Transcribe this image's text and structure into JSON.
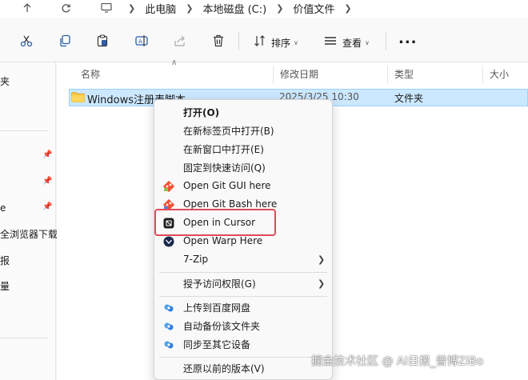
{
  "address": {
    "crumbs": [
      "此电脑",
      "本地磁盘 (C:)",
      "价值文件"
    ]
  },
  "toolbar": {
    "sort_label": "排序",
    "view_label": "查看",
    "more_label": "..."
  },
  "navpane": {
    "items": [
      "夹",
      "e",
      "全浏览器下载",
      "报",
      "量"
    ]
  },
  "filelist": {
    "columns": [
      "名称",
      "修改日期",
      "类型",
      "大小"
    ],
    "rows": [
      {
        "name": "Windows注册表脚本",
        "modified": "2025/3/25 10:30",
        "type": "文件夹",
        "size": ""
      }
    ]
  },
  "context_menu": {
    "items": [
      {
        "label": "打开(O)",
        "icon": "",
        "submenu": false,
        "bold": true
      },
      {
        "label": "在新标签页中打开(B)",
        "icon": "",
        "submenu": false
      },
      {
        "label": "在新窗口中打开(E)",
        "icon": "",
        "submenu": false
      },
      {
        "label": "固定到快速访问(Q)",
        "icon": "",
        "submenu": false
      },
      {
        "label": "Open Git GUI here",
        "icon": "git-gui-icon",
        "submenu": false
      },
      {
        "label": "Open Git Bash here",
        "icon": "git-bash-icon",
        "submenu": false
      },
      {
        "label": "Open in Cursor",
        "icon": "cursor-app-icon",
        "submenu": false
      },
      {
        "label": "Open Warp Here",
        "icon": "warp-icon",
        "submenu": false
      },
      {
        "label": "7-Zip",
        "icon": "",
        "submenu": true
      },
      {
        "label": "授予访问权限(G)",
        "icon": "",
        "submenu": true
      },
      {
        "label": "上传到百度网盘",
        "icon": "baidu-netdisk-icon",
        "submenu": false
      },
      {
        "label": "自动备份该文件夹",
        "icon": "baidu-netdisk-icon",
        "submenu": false
      },
      {
        "label": "同步至其它设备",
        "icon": "baidu-netdisk-icon",
        "submenu": false
      },
      {
        "label": "还原以前的版本(V)",
        "icon": "",
        "submenu": false
      }
    ]
  },
  "watermark": "掘金技术社区 @ AI日报_普博ZiBo",
  "colors": {
    "selection": "#cce8ff",
    "highlight_border": "#e04a5a",
    "accent": "#0067c0"
  }
}
